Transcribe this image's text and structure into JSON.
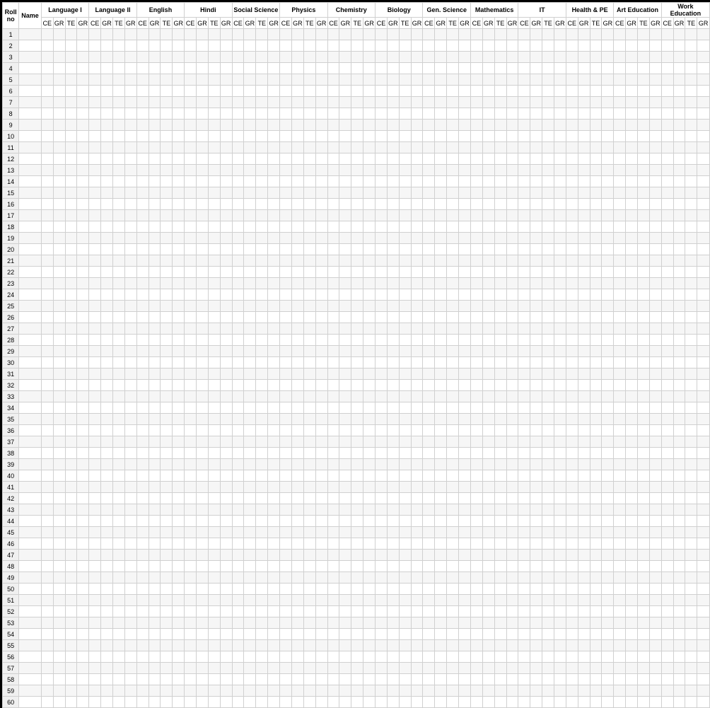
{
  "header": {
    "roll_no": "Roll no",
    "name": "Name",
    "subjects": [
      "Language I",
      "Language II",
      "English",
      "Hindi",
      "Social Science",
      "Physics",
      "Chemistry",
      "Biology",
      "Gen. Science",
      "Mathematics",
      "IT",
      "Health & PE",
      "Art Education",
      "Work Education"
    ],
    "sub_columns": [
      "CE",
      "GR",
      "TE",
      "GR"
    ]
  },
  "rows": {
    "count": 60
  }
}
